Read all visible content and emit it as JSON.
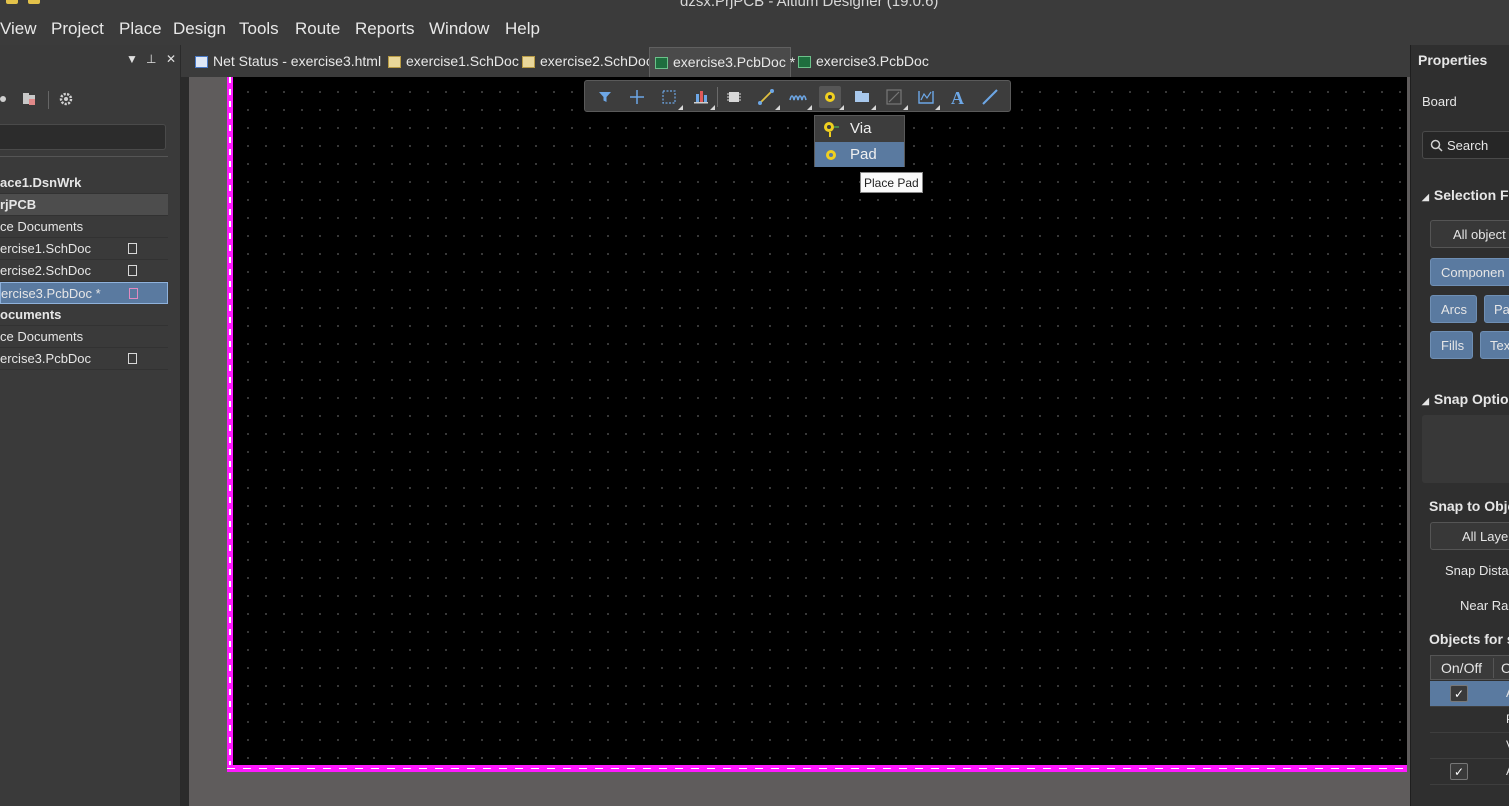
{
  "window": {
    "title": "dzsx.PrjPCB - Altium Designer (19.0.6)"
  },
  "menu": {
    "items": [
      {
        "label": "View"
      },
      {
        "label": "Project"
      },
      {
        "label": "Place"
      },
      {
        "label": "Design"
      },
      {
        "label": "Tools"
      },
      {
        "label": "Route"
      },
      {
        "label": "Reports"
      },
      {
        "label": "Window"
      },
      {
        "label": "Help"
      }
    ]
  },
  "left_panel": {
    "tree": [
      {
        "label": "ace1.DsnWrk"
      },
      {
        "label": "rjPCB"
      },
      {
        "label": "ce Documents"
      },
      {
        "label": "ercise1.SchDoc"
      },
      {
        "label": "ercise2.SchDoc"
      },
      {
        "label": "ercise3.PcbDoc *"
      },
      {
        "label": "ocuments"
      },
      {
        "label": "ce Documents"
      },
      {
        "label": "ercise3.PcbDoc"
      }
    ]
  },
  "tabs": [
    {
      "label": "Net Status - exercise3.html",
      "icon": "html-doc-icon"
    },
    {
      "label": "exercise1.SchDoc",
      "icon": "schematic-doc-icon"
    },
    {
      "label": "exercise2.SchDoc",
      "icon": "schematic-doc-icon"
    },
    {
      "label": "exercise3.PcbDoc *",
      "icon": "pcb-doc-icon",
      "active": true
    },
    {
      "label": "exercise3.PcbDoc",
      "icon": "pcb-doc-icon"
    }
  ],
  "active_bar": {
    "buttons": [
      "filter-icon",
      "crosshair-icon",
      "select-rectangle-icon",
      "align-icon",
      "component-icon",
      "route-icon",
      "tune-length-icon",
      "pad-icon",
      "region-icon",
      "graphic-icon",
      "dimension-icon",
      "string-text-icon",
      "line-icon"
    ]
  },
  "dropdown": {
    "items": [
      {
        "label": "Via",
        "icon": "via-icon"
      },
      {
        "label": "Pad",
        "icon": "pad-icon"
      }
    ],
    "tooltip": "Place Pad"
  },
  "right_panel": {
    "title": "Properties",
    "board_label": "Board",
    "search_placeholder": "Search",
    "selection_filter": "Selection Fi",
    "all_objects": "All object",
    "components": "Componen",
    "arcs": "Arcs",
    "pads": "Pa",
    "fills": "Fills",
    "texts": "Tex",
    "snap_options": "Snap Optio",
    "snap_to_objects": "Snap to Obje",
    "all_layers": "All Laye",
    "snap_distance": "Snap Dista",
    "near_range": "Near Ra",
    "objects_for_snapping": "Objects for s",
    "table_header": "On/Off",
    "table_header_2": "O",
    "rows": [
      {
        "checked": true,
        "cell": "A",
        "selected": true
      },
      {
        "checked": false,
        "cell": "P"
      },
      {
        "checked": false,
        "cell": "V"
      },
      {
        "checked": true,
        "cell": "A"
      }
    ]
  },
  "colors": {
    "accent": "#5a7aa0",
    "board_outline": "#ff19ff",
    "board_background": "#000000",
    "workspace": "#5f5c5c"
  }
}
